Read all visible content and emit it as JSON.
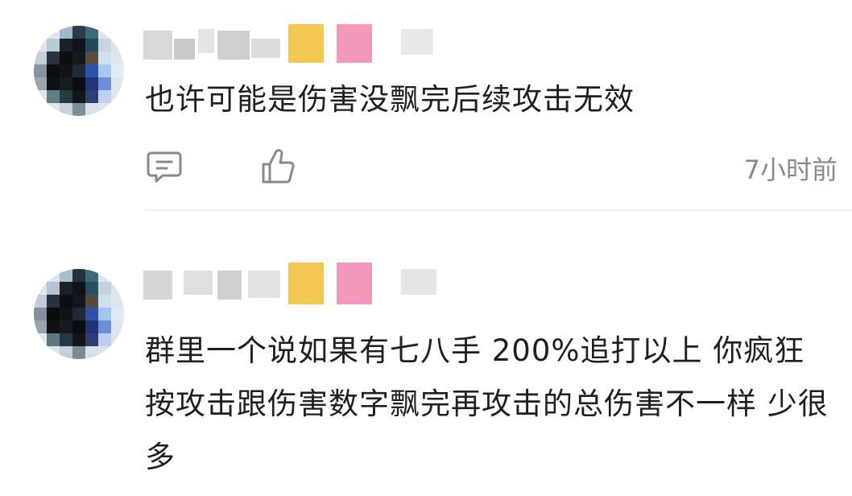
{
  "comments": [
    {
      "text": "也许可能是伤害没飘完后续攻击无效",
      "time": "7小时前",
      "icons": {
        "reply": "comment-reply-icon",
        "like": "thumbs-up-icon"
      },
      "name_blurred": true,
      "avatar_blurred": true
    },
    {
      "text": "群里一个说如果有七八手 200%追打以上  你疯狂按攻击跟伤害数字飘完再攻击的总伤害不一样  少很多",
      "name_blurred": true,
      "avatar_blurred": true
    }
  ],
  "colors": {
    "text": "#1f1f1f",
    "muted": "#8a8a8a",
    "divider": "#f0f0f0",
    "emoji_yellow": "#f3c242",
    "emoji_pink": "#f28cb8"
  }
}
